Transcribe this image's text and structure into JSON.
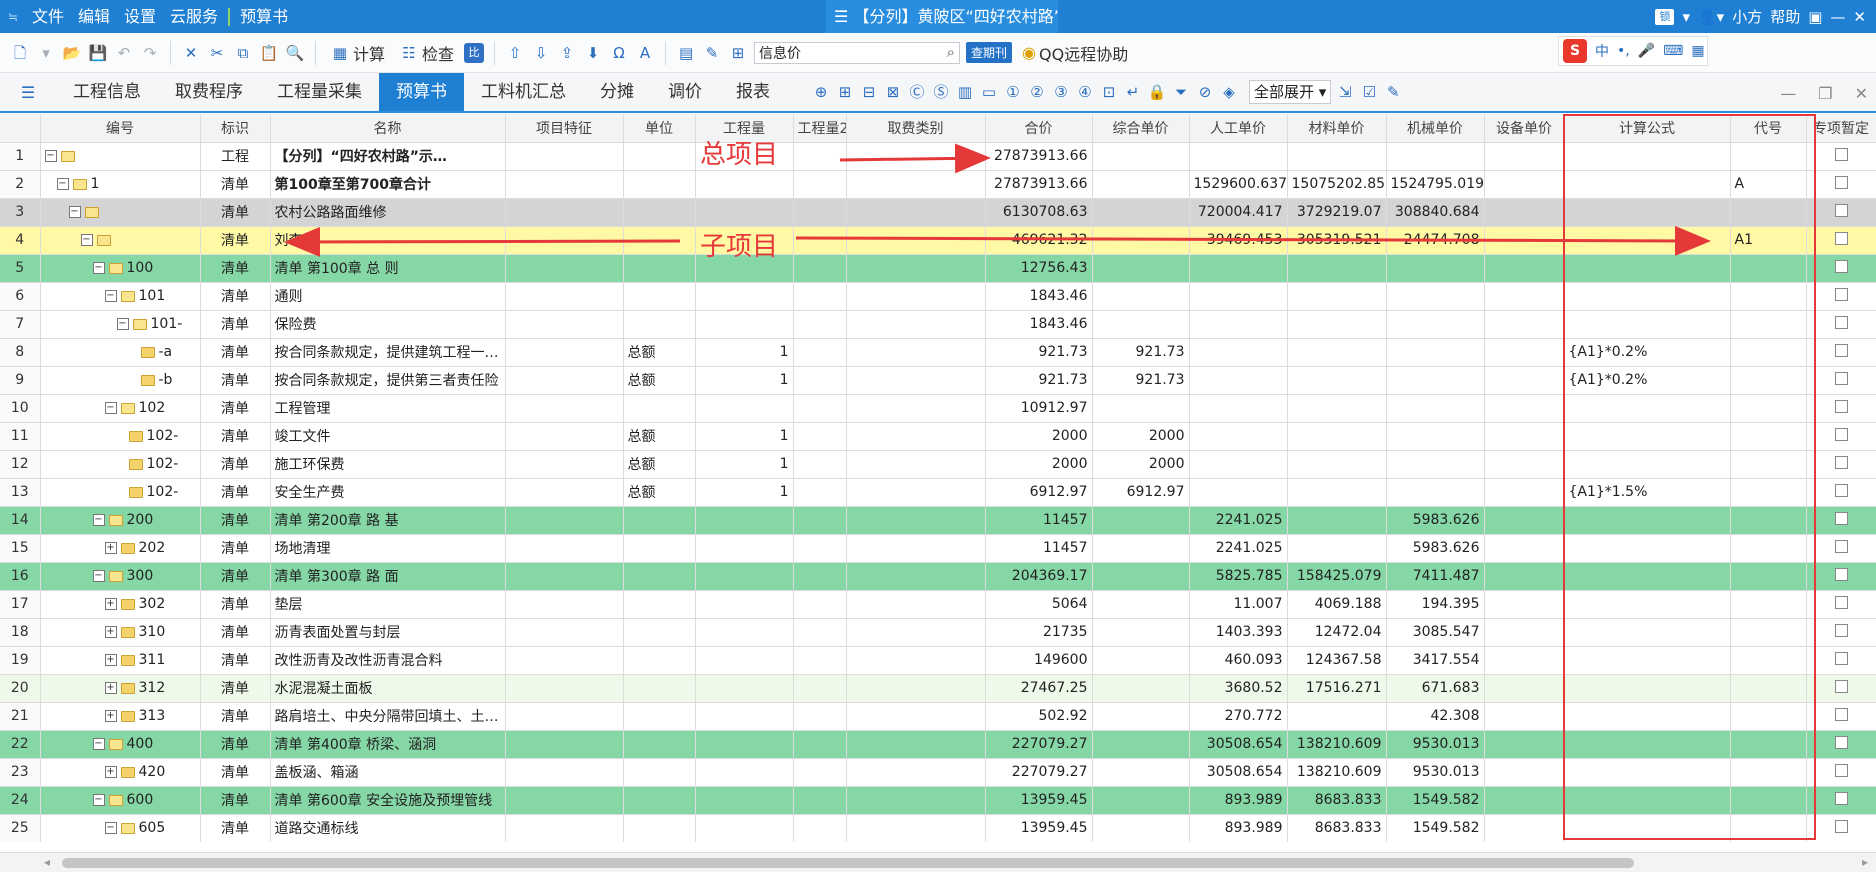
{
  "titlebar": {
    "menu": [
      "文件",
      "编辑",
      "设置",
      "云服务",
      "预算书"
    ],
    "window_title": "【分列】黄陂区“四好农村路”",
    "account_chip": "锁",
    "user": "小方",
    "help": "帮助"
  },
  "toolbar": {
    "calc_label": "计算",
    "check_label": "检查",
    "search_value": "信息价",
    "periodic_label": "查期刊",
    "qq_label": "QQ远程协助",
    "ime_label": "中"
  },
  "tabs": [
    "工程信息",
    "取费程序",
    "工程量采集",
    "预算书",
    "工料机汇总",
    "分摊",
    "调价",
    "报表"
  ],
  "active_tab": "预算书",
  "expand_select": "全部展开",
  "columns": [
    "",
    "编号",
    "标识",
    "名称",
    "项目特征",
    "单位",
    "工程量",
    "工程量2",
    "取费类别",
    "合价",
    "综合单价",
    "人工单价",
    "材料单价",
    "机械单价",
    "设备单价",
    "计算公式",
    "代号",
    "专项暂定"
  ],
  "rows": [
    {
      "n": "1",
      "code": "",
      "flag": "工程",
      "name": "【分列】“四好农村路”示…",
      "feature": "",
      "unit": "",
      "qty": "",
      "qty2": "",
      "fee": "",
      "total": "27873913.66",
      "unit_price": "",
      "labor": "",
      "material": "",
      "machine": "",
      "equip": "",
      "formula": "",
      "alias": ""
    },
    {
      "n": "2",
      "code": "1",
      "flag": "清单",
      "name": "第100章至第700章合计",
      "feature": "",
      "unit": "",
      "qty": "",
      "qty2": "",
      "fee": "",
      "total": "27873913.66",
      "unit_price": "",
      "labor": "1529600.637",
      "material": "15075202.85",
      "machine": "1524795.019",
      "equip": "",
      "formula": "",
      "alias": "A"
    },
    {
      "n": "3",
      "code": "",
      "flag": "清单",
      "name": "农村公路路面维修",
      "feature": "",
      "unit": "",
      "qty": "",
      "qty2": "",
      "fee": "",
      "total": "6130708.63",
      "unit_price": "",
      "labor": "720004.417",
      "material": "3729219.07",
      "machine": "308840.684",
      "equip": "",
      "formula": "",
      "alias": ""
    },
    {
      "n": "4",
      "code": "",
      "flag": "清单",
      "name": "刘李线",
      "feature": "",
      "unit": "",
      "qty": "",
      "qty2": "",
      "fee": "",
      "total": "469621.32",
      "unit_price": "",
      "labor": "39469.453",
      "material": "305319.521",
      "machine": "24474.708",
      "equip": "",
      "formula": "",
      "alias": "A1"
    },
    {
      "n": "5",
      "code": "100",
      "flag": "清单",
      "name": "清单 第100章 总 则",
      "feature": "",
      "unit": "",
      "qty": "",
      "qty2": "",
      "fee": "",
      "total": "12756.43",
      "unit_price": "",
      "labor": "",
      "material": "",
      "machine": "",
      "equip": "",
      "formula": "",
      "alias": ""
    },
    {
      "n": "6",
      "code": "101",
      "flag": "清单",
      "name": "通则",
      "feature": "",
      "unit": "",
      "qty": "",
      "qty2": "",
      "fee": "",
      "total": "1843.46",
      "unit_price": "",
      "labor": "",
      "material": "",
      "machine": "",
      "equip": "",
      "formula": "",
      "alias": ""
    },
    {
      "n": "7",
      "code": "101-",
      "flag": "清单",
      "name": "保险费",
      "feature": "",
      "unit": "",
      "qty": "",
      "qty2": "",
      "fee": "",
      "total": "1843.46",
      "unit_price": "",
      "labor": "",
      "material": "",
      "machine": "",
      "equip": "",
      "formula": "",
      "alias": ""
    },
    {
      "n": "8",
      "code": "-a",
      "flag": "清单",
      "name": "按合同条款规定，提供建筑工程一…",
      "feature": "",
      "unit": "总额",
      "qty": "1",
      "qty2": "",
      "fee": "",
      "total": "921.73",
      "unit_price": "921.73",
      "labor": "",
      "material": "",
      "machine": "",
      "equip": "",
      "formula": "{A1}*0.2%",
      "alias": ""
    },
    {
      "n": "9",
      "code": "-b",
      "flag": "清单",
      "name": "按合同条款规定，提供第三者责任险",
      "feature": "",
      "unit": "总额",
      "qty": "1",
      "qty2": "",
      "fee": "",
      "total": "921.73",
      "unit_price": "921.73",
      "labor": "",
      "material": "",
      "machine": "",
      "equip": "",
      "formula": "{A1}*0.2%",
      "alias": ""
    },
    {
      "n": "10",
      "code": "102",
      "flag": "清单",
      "name": "工程管理",
      "feature": "",
      "unit": "",
      "qty": "",
      "qty2": "",
      "fee": "",
      "total": "10912.97",
      "unit_price": "",
      "labor": "",
      "material": "",
      "machine": "",
      "equip": "",
      "formula": "",
      "alias": ""
    },
    {
      "n": "11",
      "code": "102-",
      "flag": "清单",
      "name": "竣工文件",
      "feature": "",
      "unit": "总额",
      "qty": "1",
      "qty2": "",
      "fee": "",
      "total": "2000",
      "unit_price": "2000",
      "labor": "",
      "material": "",
      "machine": "",
      "equip": "",
      "formula": "",
      "alias": ""
    },
    {
      "n": "12",
      "code": "102-",
      "flag": "清单",
      "name": "施工环保费",
      "feature": "",
      "unit": "总额",
      "qty": "1",
      "qty2": "",
      "fee": "",
      "total": "2000",
      "unit_price": "2000",
      "labor": "",
      "material": "",
      "machine": "",
      "equip": "",
      "formula": "",
      "alias": ""
    },
    {
      "n": "13",
      "code": "102-",
      "flag": "清单",
      "name": "安全生产费",
      "feature": "",
      "unit": "总额",
      "qty": "1",
      "qty2": "",
      "fee": "",
      "total": "6912.97",
      "unit_price": "6912.97",
      "labor": "",
      "material": "",
      "machine": "",
      "equip": "",
      "formula": "{A1}*1.5%",
      "alias": ""
    },
    {
      "n": "14",
      "code": "200",
      "flag": "清单",
      "name": "清单 第200章 路 基",
      "feature": "",
      "unit": "",
      "qty": "",
      "qty2": "",
      "fee": "",
      "total": "11457",
      "unit_price": "",
      "labor": "2241.025",
      "material": "",
      "machine": "5983.626",
      "equip": "",
      "formula": "",
      "alias": ""
    },
    {
      "n": "15",
      "code": "202",
      "flag": "清单",
      "name": "场地清理",
      "feature": "",
      "unit": "",
      "qty": "",
      "qty2": "",
      "fee": "",
      "total": "11457",
      "unit_price": "",
      "labor": "2241.025",
      "material": "",
      "machine": "5983.626",
      "equip": "",
      "formula": "",
      "alias": ""
    },
    {
      "n": "16",
      "code": "300",
      "flag": "清单",
      "name": "清单 第300章 路 面",
      "feature": "",
      "unit": "",
      "qty": "",
      "qty2": "",
      "fee": "",
      "total": "204369.17",
      "unit_price": "",
      "labor": "5825.785",
      "material": "158425.079",
      "machine": "7411.487",
      "equip": "",
      "formula": "",
      "alias": ""
    },
    {
      "n": "17",
      "code": "302",
      "flag": "清单",
      "name": "垫层",
      "feature": "",
      "unit": "",
      "qty": "",
      "qty2": "",
      "fee": "",
      "total": "5064",
      "unit_price": "",
      "labor": "11.007",
      "material": "4069.188",
      "machine": "194.395",
      "equip": "",
      "formula": "",
      "alias": ""
    },
    {
      "n": "18",
      "code": "310",
      "flag": "清单",
      "name": "沥青表面处置与封层",
      "feature": "",
      "unit": "",
      "qty": "",
      "qty2": "",
      "fee": "",
      "total": "21735",
      "unit_price": "",
      "labor": "1403.393",
      "material": "12472.04",
      "machine": "3085.547",
      "equip": "",
      "formula": "",
      "alias": ""
    },
    {
      "n": "19",
      "code": "311",
      "flag": "清单",
      "name": "改性沥青及改性沥青混合料",
      "feature": "",
      "unit": "",
      "qty": "",
      "qty2": "",
      "fee": "",
      "total": "149600",
      "unit_price": "",
      "labor": "460.093",
      "material": "124367.58",
      "machine": "3417.554",
      "equip": "",
      "formula": "",
      "alias": ""
    },
    {
      "n": "20",
      "code": "312",
      "flag": "清单",
      "name": "水泥混凝土面板",
      "feature": "",
      "unit": "",
      "qty": "",
      "qty2": "",
      "fee": "",
      "total": "27467.25",
      "unit_price": "",
      "labor": "3680.52",
      "material": "17516.271",
      "machine": "671.683",
      "equip": "",
      "formula": "",
      "alias": ""
    },
    {
      "n": "21",
      "code": "313",
      "flag": "清单",
      "name": "路肩培土、中央分隔带回填土、土…",
      "feature": "",
      "unit": "",
      "qty": "",
      "qty2": "",
      "fee": "",
      "total": "502.92",
      "unit_price": "",
      "labor": "270.772",
      "material": "",
      "machine": "42.308",
      "equip": "",
      "formula": "",
      "alias": ""
    },
    {
      "n": "22",
      "code": "400",
      "flag": "清单",
      "name": "清单 第400章 桥梁、涵洞",
      "feature": "",
      "unit": "",
      "qty": "",
      "qty2": "",
      "fee": "",
      "total": "227079.27",
      "unit_price": "",
      "labor": "30508.654",
      "material": "138210.609",
      "machine": "9530.013",
      "equip": "",
      "formula": "",
      "alias": ""
    },
    {
      "n": "23",
      "code": "420",
      "flag": "清单",
      "name": "盖板涵、箱涵",
      "feature": "",
      "unit": "",
      "qty": "",
      "qty2": "",
      "fee": "",
      "total": "227079.27",
      "unit_price": "",
      "labor": "30508.654",
      "material": "138210.609",
      "machine": "9530.013",
      "equip": "",
      "formula": "",
      "alias": ""
    },
    {
      "n": "24",
      "code": "600",
      "flag": "清单",
      "name": "清单 第600章 安全设施及预埋管线",
      "feature": "",
      "unit": "",
      "qty": "",
      "qty2": "",
      "fee": "",
      "total": "13959.45",
      "unit_price": "",
      "labor": "893.989",
      "material": "8683.833",
      "machine": "1549.582",
      "equip": "",
      "formula": "",
      "alias": ""
    },
    {
      "n": "25",
      "code": "605",
      "flag": "清单",
      "name": "道路交通标线",
      "feature": "",
      "unit": "",
      "qty": "",
      "qty2": "",
      "fee": "",
      "total": "13959.45",
      "unit_price": "",
      "labor": "893.989",
      "material": "8683.833",
      "machine": "1549.582",
      "equip": "",
      "formula": "",
      "alias": ""
    }
  ],
  "annotations": {
    "total_project": "总项目",
    "sub_project": "子项目"
  },
  "colors": {
    "title_blue": "#1e7fd3",
    "selected_row": "#fff9a6",
    "chapter_row": "#86d7a6",
    "annotation_red": "#e53838"
  }
}
